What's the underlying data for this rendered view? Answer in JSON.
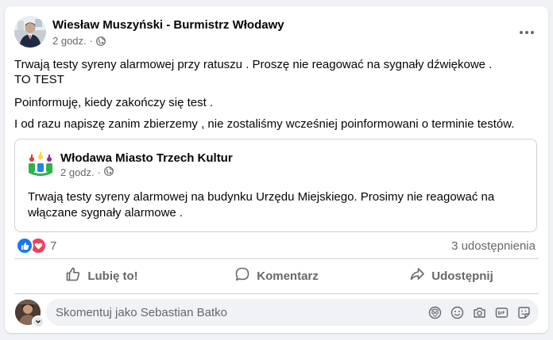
{
  "post": {
    "author": "Wiesław Muszyński - Burmistrz Włodawy",
    "time": "2 godz.",
    "paragraphs": [
      "Trwają testy syreny alarmowej przy ratuszu . Proszę nie reagować na sygnały dźwiękowe .",
      "TO TEST",
      "Poinformuję, kiedy zakończy się test .",
      "I od razu napiszę zanim zbierzemy , nie zostaliśmy wcześniej poinformowani o terminie testów."
    ]
  },
  "shared": {
    "page_name": "Włodawa Miasto Trzech Kultur",
    "time": "2 godz.",
    "text": "Trwają testy syreny alarmowej na budynku Urzędu Miejskiego. Prosimy nie reagować na włączane sygnały alarmowe ."
  },
  "stats": {
    "reaction_count": "7",
    "shares": "3 udostępnienia"
  },
  "actions": {
    "like": "Lubię to!",
    "comment": "Komentarz",
    "share": "Udostępnij"
  },
  "comment": {
    "placeholder": "Skomentuj jako Sebastian Batko"
  },
  "icons": {
    "privacy": "globe-icon",
    "more": "more-icon",
    "like": "thumbs-up-icon",
    "comment": "speech-bubble-icon",
    "share": "share-arrow-icon"
  },
  "colors": {
    "like_blue": "#1877f2",
    "love_red": "#f33e58",
    "secondary_text": "#65676b"
  }
}
